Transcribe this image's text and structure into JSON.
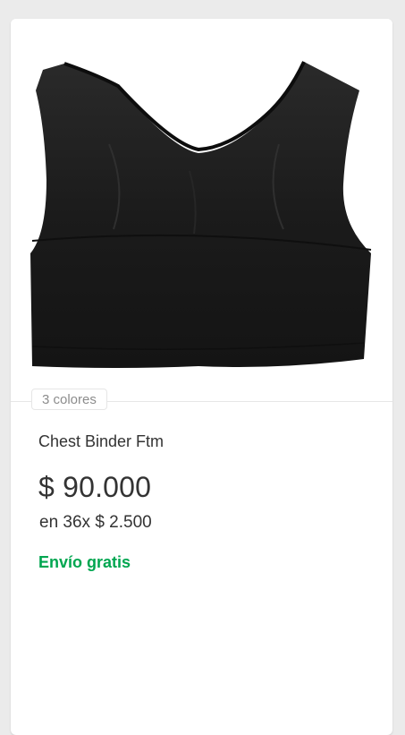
{
  "product": {
    "image_alt": "black tank crop top",
    "colors_label": "3 colores",
    "title": "Chest Binder Ftm",
    "price": "$ 90.000",
    "installments": "en 36x $ 2.500",
    "shipping": "Envío gratis"
  },
  "colors": {
    "page_bg": "#ebebeb",
    "card_bg": "#ffffff",
    "text": "#333333",
    "muted": "#8c8c8c",
    "shipping_green": "#00a650",
    "garment": "#1e1e1e"
  }
}
